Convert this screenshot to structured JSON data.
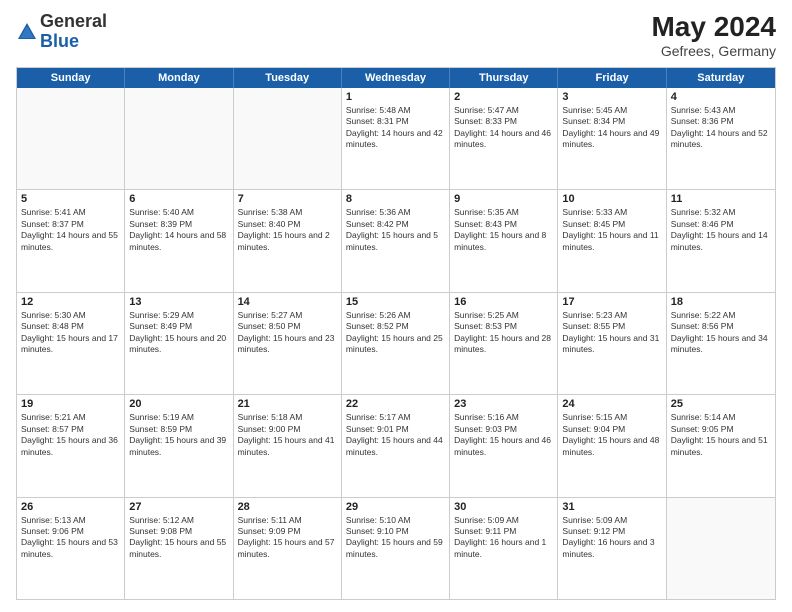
{
  "header": {
    "logo_general": "General",
    "logo_blue": "Blue",
    "month_year": "May 2024",
    "location": "Gefrees, Germany"
  },
  "days_of_week": [
    "Sunday",
    "Monday",
    "Tuesday",
    "Wednesday",
    "Thursday",
    "Friday",
    "Saturday"
  ],
  "weeks": [
    [
      {
        "day": "",
        "sunrise": "",
        "sunset": "",
        "daylight": ""
      },
      {
        "day": "",
        "sunrise": "",
        "sunset": "",
        "daylight": ""
      },
      {
        "day": "",
        "sunrise": "",
        "sunset": "",
        "daylight": ""
      },
      {
        "day": "1",
        "sunrise": "Sunrise: 5:48 AM",
        "sunset": "Sunset: 8:31 PM",
        "daylight": "Daylight: 14 hours and 42 minutes."
      },
      {
        "day": "2",
        "sunrise": "Sunrise: 5:47 AM",
        "sunset": "Sunset: 8:33 PM",
        "daylight": "Daylight: 14 hours and 46 minutes."
      },
      {
        "day": "3",
        "sunrise": "Sunrise: 5:45 AM",
        "sunset": "Sunset: 8:34 PM",
        "daylight": "Daylight: 14 hours and 49 minutes."
      },
      {
        "day": "4",
        "sunrise": "Sunrise: 5:43 AM",
        "sunset": "Sunset: 8:36 PM",
        "daylight": "Daylight: 14 hours and 52 minutes."
      }
    ],
    [
      {
        "day": "5",
        "sunrise": "Sunrise: 5:41 AM",
        "sunset": "Sunset: 8:37 PM",
        "daylight": "Daylight: 14 hours and 55 minutes."
      },
      {
        "day": "6",
        "sunrise": "Sunrise: 5:40 AM",
        "sunset": "Sunset: 8:39 PM",
        "daylight": "Daylight: 14 hours and 58 minutes."
      },
      {
        "day": "7",
        "sunrise": "Sunrise: 5:38 AM",
        "sunset": "Sunset: 8:40 PM",
        "daylight": "Daylight: 15 hours and 2 minutes."
      },
      {
        "day": "8",
        "sunrise": "Sunrise: 5:36 AM",
        "sunset": "Sunset: 8:42 PM",
        "daylight": "Daylight: 15 hours and 5 minutes."
      },
      {
        "day": "9",
        "sunrise": "Sunrise: 5:35 AM",
        "sunset": "Sunset: 8:43 PM",
        "daylight": "Daylight: 15 hours and 8 minutes."
      },
      {
        "day": "10",
        "sunrise": "Sunrise: 5:33 AM",
        "sunset": "Sunset: 8:45 PM",
        "daylight": "Daylight: 15 hours and 11 minutes."
      },
      {
        "day": "11",
        "sunrise": "Sunrise: 5:32 AM",
        "sunset": "Sunset: 8:46 PM",
        "daylight": "Daylight: 15 hours and 14 minutes."
      }
    ],
    [
      {
        "day": "12",
        "sunrise": "Sunrise: 5:30 AM",
        "sunset": "Sunset: 8:48 PM",
        "daylight": "Daylight: 15 hours and 17 minutes."
      },
      {
        "day": "13",
        "sunrise": "Sunrise: 5:29 AM",
        "sunset": "Sunset: 8:49 PM",
        "daylight": "Daylight: 15 hours and 20 minutes."
      },
      {
        "day": "14",
        "sunrise": "Sunrise: 5:27 AM",
        "sunset": "Sunset: 8:50 PM",
        "daylight": "Daylight: 15 hours and 23 minutes."
      },
      {
        "day": "15",
        "sunrise": "Sunrise: 5:26 AM",
        "sunset": "Sunset: 8:52 PM",
        "daylight": "Daylight: 15 hours and 25 minutes."
      },
      {
        "day": "16",
        "sunrise": "Sunrise: 5:25 AM",
        "sunset": "Sunset: 8:53 PM",
        "daylight": "Daylight: 15 hours and 28 minutes."
      },
      {
        "day": "17",
        "sunrise": "Sunrise: 5:23 AM",
        "sunset": "Sunset: 8:55 PM",
        "daylight": "Daylight: 15 hours and 31 minutes."
      },
      {
        "day": "18",
        "sunrise": "Sunrise: 5:22 AM",
        "sunset": "Sunset: 8:56 PM",
        "daylight": "Daylight: 15 hours and 34 minutes."
      }
    ],
    [
      {
        "day": "19",
        "sunrise": "Sunrise: 5:21 AM",
        "sunset": "Sunset: 8:57 PM",
        "daylight": "Daylight: 15 hours and 36 minutes."
      },
      {
        "day": "20",
        "sunrise": "Sunrise: 5:19 AM",
        "sunset": "Sunset: 8:59 PM",
        "daylight": "Daylight: 15 hours and 39 minutes."
      },
      {
        "day": "21",
        "sunrise": "Sunrise: 5:18 AM",
        "sunset": "Sunset: 9:00 PM",
        "daylight": "Daylight: 15 hours and 41 minutes."
      },
      {
        "day": "22",
        "sunrise": "Sunrise: 5:17 AM",
        "sunset": "Sunset: 9:01 PM",
        "daylight": "Daylight: 15 hours and 44 minutes."
      },
      {
        "day": "23",
        "sunrise": "Sunrise: 5:16 AM",
        "sunset": "Sunset: 9:03 PM",
        "daylight": "Daylight: 15 hours and 46 minutes."
      },
      {
        "day": "24",
        "sunrise": "Sunrise: 5:15 AM",
        "sunset": "Sunset: 9:04 PM",
        "daylight": "Daylight: 15 hours and 48 minutes."
      },
      {
        "day": "25",
        "sunrise": "Sunrise: 5:14 AM",
        "sunset": "Sunset: 9:05 PM",
        "daylight": "Daylight: 15 hours and 51 minutes."
      }
    ],
    [
      {
        "day": "26",
        "sunrise": "Sunrise: 5:13 AM",
        "sunset": "Sunset: 9:06 PM",
        "daylight": "Daylight: 15 hours and 53 minutes."
      },
      {
        "day": "27",
        "sunrise": "Sunrise: 5:12 AM",
        "sunset": "Sunset: 9:08 PM",
        "daylight": "Daylight: 15 hours and 55 minutes."
      },
      {
        "day": "28",
        "sunrise": "Sunrise: 5:11 AM",
        "sunset": "Sunset: 9:09 PM",
        "daylight": "Daylight: 15 hours and 57 minutes."
      },
      {
        "day": "29",
        "sunrise": "Sunrise: 5:10 AM",
        "sunset": "Sunset: 9:10 PM",
        "daylight": "Daylight: 15 hours and 59 minutes."
      },
      {
        "day": "30",
        "sunrise": "Sunrise: 5:09 AM",
        "sunset": "Sunset: 9:11 PM",
        "daylight": "Daylight: 16 hours and 1 minute."
      },
      {
        "day": "31",
        "sunrise": "Sunrise: 5:09 AM",
        "sunset": "Sunset: 9:12 PM",
        "daylight": "Daylight: 16 hours and 3 minutes."
      },
      {
        "day": "",
        "sunrise": "",
        "sunset": "",
        "daylight": ""
      }
    ]
  ]
}
